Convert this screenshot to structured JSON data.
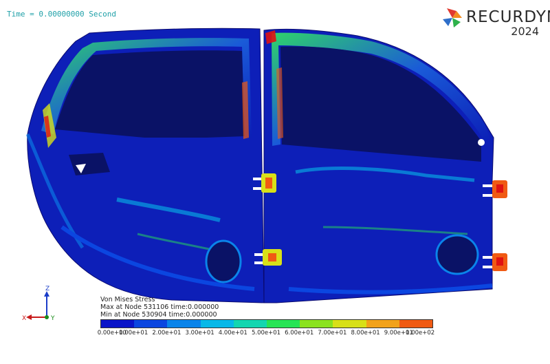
{
  "header": {
    "time_readout": "Time = 0.00000000 Second"
  },
  "brand": {
    "name": "RECURDYN",
    "year": "2024",
    "logo_colors": [
      "#e03a2f",
      "#f28c1e",
      "#2eb14b",
      "#2f6fc9"
    ]
  },
  "axis_triad": {
    "z_label": "Z",
    "x_label": "X",
    "y_label": "Y"
  },
  "result_info": {
    "line1": "Von Mises Stress",
    "line2": "Max at Node 531106 time:0.000000",
    "line3": "Min at Node 530904 time:0.000000"
  },
  "legend": {
    "colors": [
      "#0a14c8",
      "#0b46e0",
      "#0a84ea",
      "#07b8e8",
      "#13d6b0",
      "#27e455",
      "#8be21f",
      "#d8e018",
      "#f2a21a",
      "#f05a13",
      "#e01212"
    ],
    "ticks": [
      "0.00e+00",
      "1.00e+01",
      "2.00e+01",
      "3.00e+01",
      "4.00e+01",
      "5.00e+01",
      "6.00e+01",
      "7.00e+01",
      "8.00e+01",
      "9.00e+01",
      "1.00e+02"
    ]
  }
}
